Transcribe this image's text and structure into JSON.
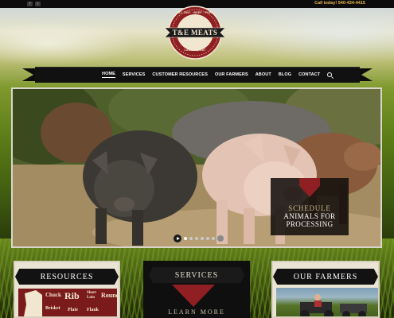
{
  "topbar": {
    "social_icons": [
      "facebook-icon",
      "twitter-icon"
    ],
    "call_text": "Call today! 540-434-4415"
  },
  "logo": {
    "top_arc": "EST. 1967 · BEEF · PORK",
    "title": "T&E MEATS",
    "bottom_arc": "LAMB · GOAT"
  },
  "nav": {
    "items": [
      {
        "label": "HOME",
        "active": true
      },
      {
        "label": "SERVICES",
        "active": false
      },
      {
        "label": "CUSTOMER RESOURCES",
        "active": false
      },
      {
        "label": "OUR FARMERS",
        "active": false
      },
      {
        "label": "ABOUT",
        "active": false
      },
      {
        "label": "BLOG",
        "active": false
      },
      {
        "label": "CONTACT",
        "active": false
      }
    ],
    "search_icon": "search-icon"
  },
  "hero": {
    "cta_line1": "SCHEDULE",
    "cta_line2": "ANIMALS FOR",
    "cta_line3": "PROCESSING",
    "slides": 6,
    "current_slide": 1
  },
  "cards": {
    "resources": {
      "title": "RESOURCES",
      "chart_words": [
        "Chuck",
        "Rib",
        "Short",
        "Loin",
        "Round",
        "Brisket",
        "Plate",
        "Flank"
      ]
    },
    "services": {
      "title": "SERVICES",
      "more_text": "LEARN MORE"
    },
    "farmers": {
      "title": "OUR FARMERS"
    }
  },
  "colors": {
    "accent_red": "#8f1f22",
    "ribbon_black": "#121212",
    "gold": "#e8b84a",
    "cream": "#e9e4d3"
  }
}
